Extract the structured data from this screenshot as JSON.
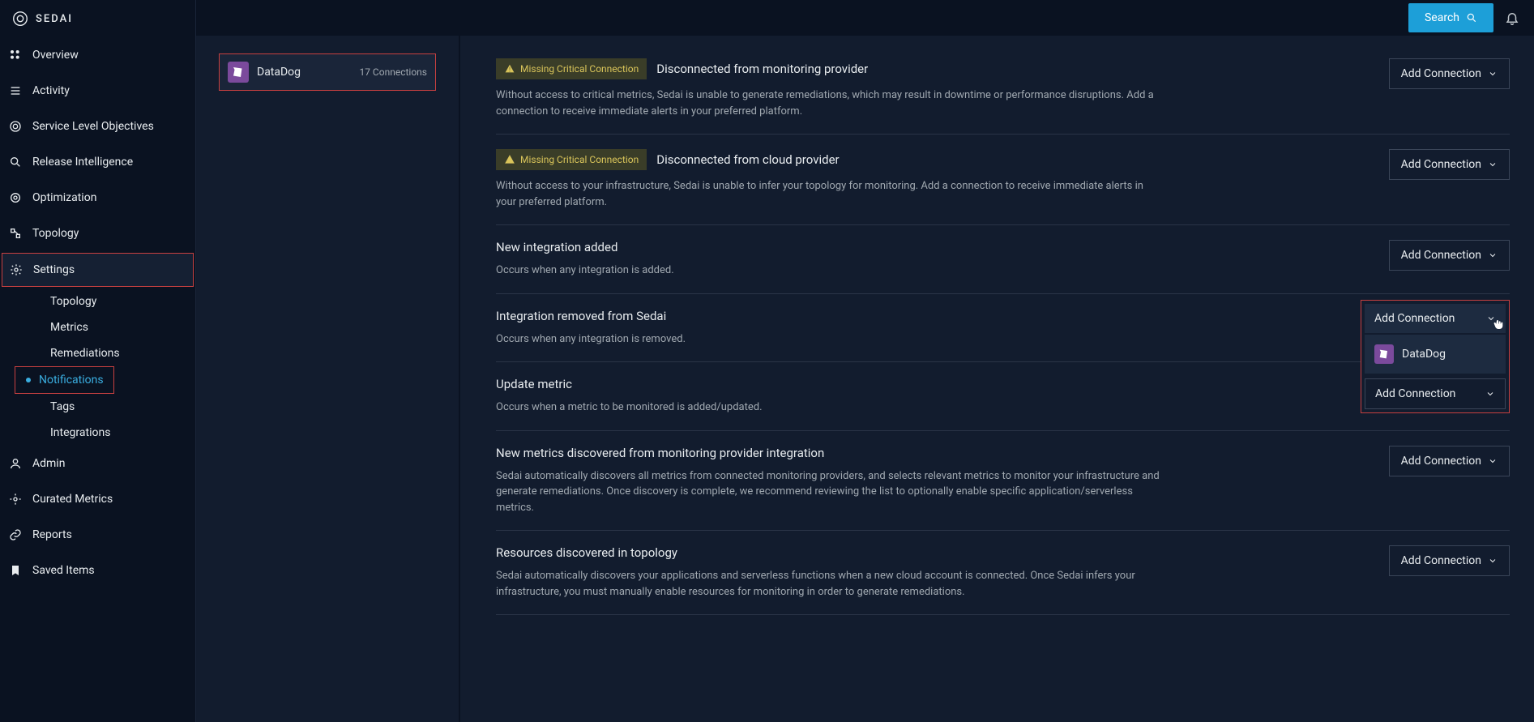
{
  "brand": {
    "name": "SEDAI"
  },
  "topbar": {
    "search_label": "Search"
  },
  "nav": {
    "overview": "Overview",
    "activity": "Activity",
    "slo": "Service Level Objectives",
    "release": "Release Intelligence",
    "optimization": "Optimization",
    "topology": "Topology",
    "settings": "Settings",
    "admin": "Admin",
    "curated": "Curated Metrics",
    "reports": "Reports",
    "saved": "Saved Items"
  },
  "settings_sub": {
    "topology": "Topology",
    "metrics": "Metrics",
    "remediations": "Remediations",
    "notifications": "Notifications",
    "tags": "Tags",
    "integrations": "Integrations"
  },
  "provider_card": {
    "name": "DataDog",
    "count": "17 Connections"
  },
  "warning_badge_label": "Missing Critical Connection",
  "add_connection_label": "Add Connection",
  "notifications": [
    {
      "warning": true,
      "title": "Disconnected from monitoring provider",
      "desc": "Without access to critical metrics, Sedai is unable to generate remediations, which may result in downtime or performance disruptions. Add a connection to receive immediate alerts in your preferred platform."
    },
    {
      "warning": true,
      "title": "Disconnected from cloud provider",
      "desc": "Without access to your infrastructure, Sedai is unable to infer your topology for monitoring. Add a connection to receive immediate alerts in your preferred platform."
    },
    {
      "warning": false,
      "title": "New integration added",
      "desc": "Occurs when any integration is added."
    },
    {
      "warning": false,
      "title": "Integration removed from Sedai",
      "desc": "Occurs when any integration is removed."
    },
    {
      "warning": false,
      "title": "Update metric",
      "desc": "Occurs when a metric to be monitored is added/updated."
    },
    {
      "warning": false,
      "title": "New metrics discovered from monitoring provider integration",
      "desc": "Sedai automatically discovers all metrics from connected monitoring providers, and selects relevant metrics to monitor your infrastructure and generate remediations. Once discovery is complete, we recommend reviewing the list to optionally enable specific application/serverless metrics."
    },
    {
      "warning": false,
      "title": "Resources discovered in topology",
      "desc": "Sedai automatically discovers your applications and serverless functions when a new cloud account is connected. Once Sedai infers your infrastructure, you must manually enable resources for monitoring in order to generate remediations."
    }
  ],
  "dropdown": {
    "header": "Add Connection",
    "option": "DataDog",
    "footer": "Add Connection"
  }
}
